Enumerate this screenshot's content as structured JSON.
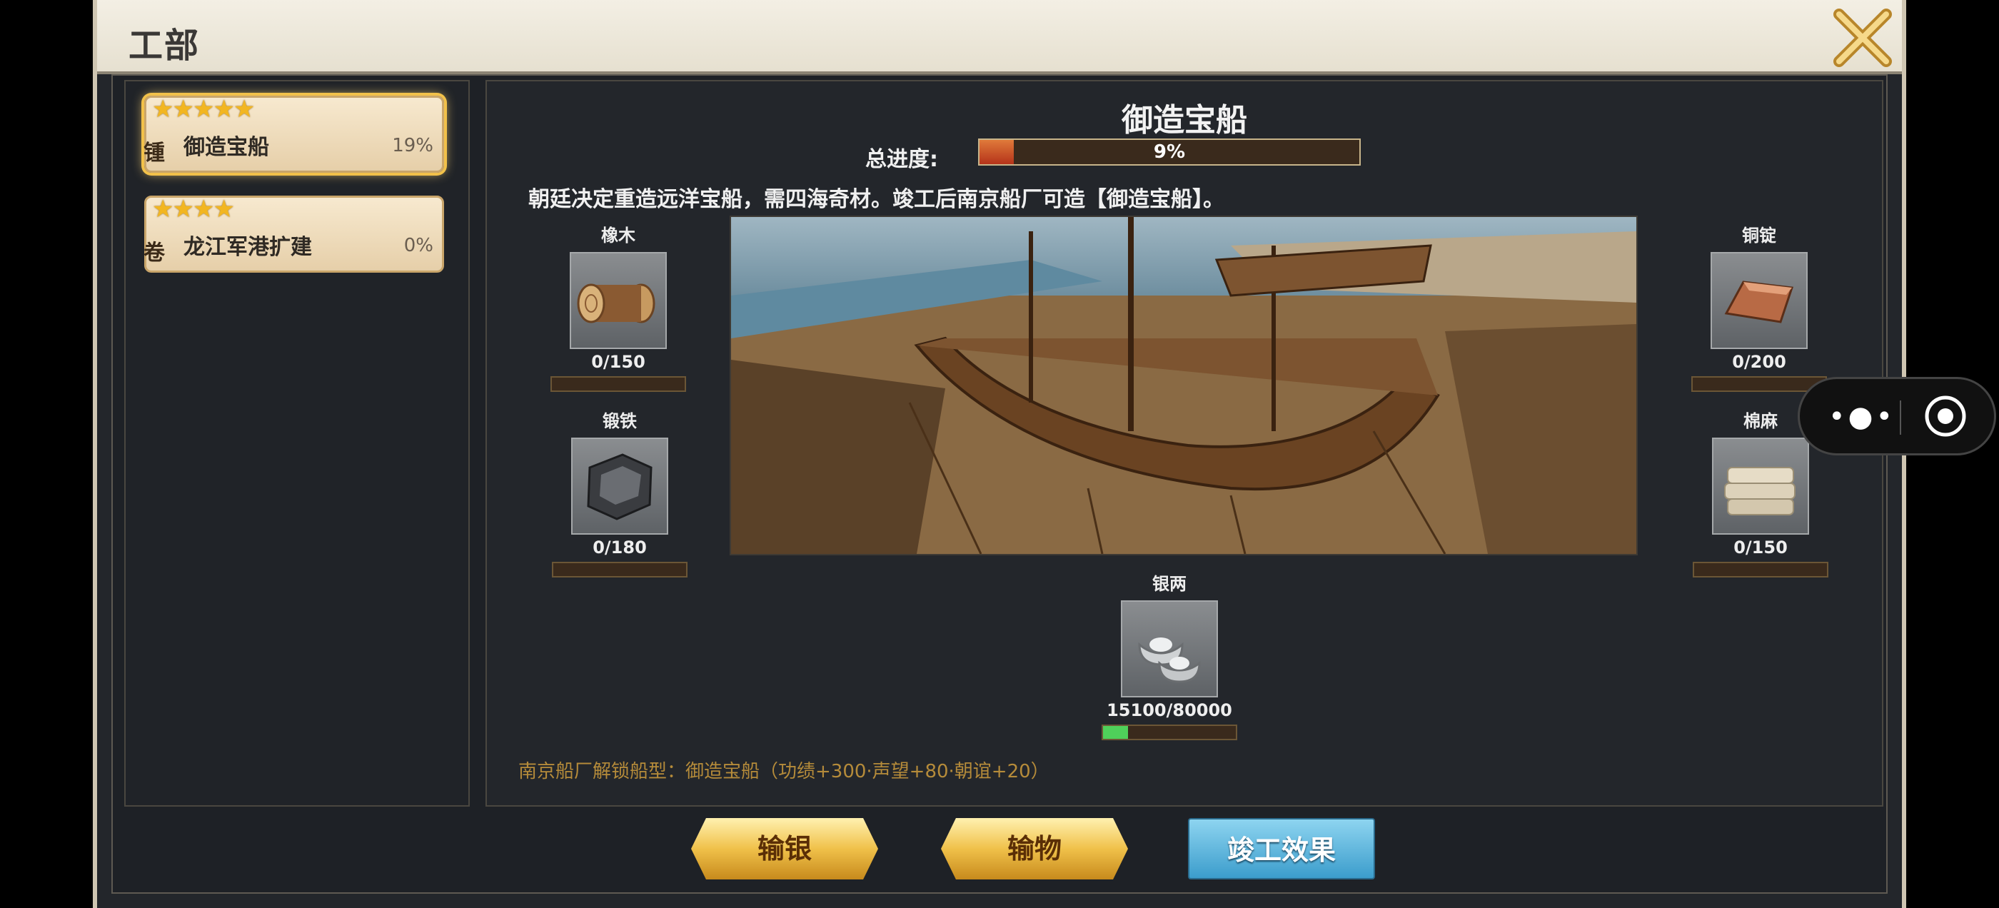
{
  "window": {
    "title": "工部"
  },
  "quests": [
    {
      "stars": "★★★★★",
      "side": "锺",
      "name": "御造宝船",
      "percent": "19%"
    },
    {
      "stars": "★★★★",
      "side": "卷",
      "name": "龙江军港扩建",
      "percent": "0%"
    }
  ],
  "detail": {
    "title": "御造宝船",
    "progress_label": "总进度:",
    "progress_text": "9%",
    "progress_value": 0.09,
    "description": "朝廷决定重造远洋宝船，需四海奇材。竣工后南京船厂可造【御造宝船】。",
    "unlock_text": "南京船厂解锁船型：御造宝船（功绩+300·声望+80·朝谊+20）"
  },
  "materials": [
    {
      "name": "橡木",
      "count": "0/150",
      "icon": "log-icon",
      "fill": 0
    },
    {
      "name": "锻铁",
      "count": "0/180",
      "icon": "iron-ore-icon",
      "fill": 0
    },
    {
      "name": "铜锭",
      "count": "0/200",
      "icon": "copper-ingot-icon",
      "fill": 0
    },
    {
      "name": "棉麻",
      "count": "0/150",
      "icon": "cloth-icon",
      "fill": 0
    },
    {
      "name": "银两",
      "count": "15100/80000",
      "icon": "silver-ingot-icon",
      "fill": 0.19
    }
  ],
  "buttons": {
    "silver": "输银",
    "goods": "输物",
    "effect": "竣工效果"
  },
  "colors": {
    "accent_gold": "#f2c14a",
    "progress_orange": "#d9622b",
    "silver_green": "#4fd05a",
    "effect_blue": "#5ab8e0"
  }
}
